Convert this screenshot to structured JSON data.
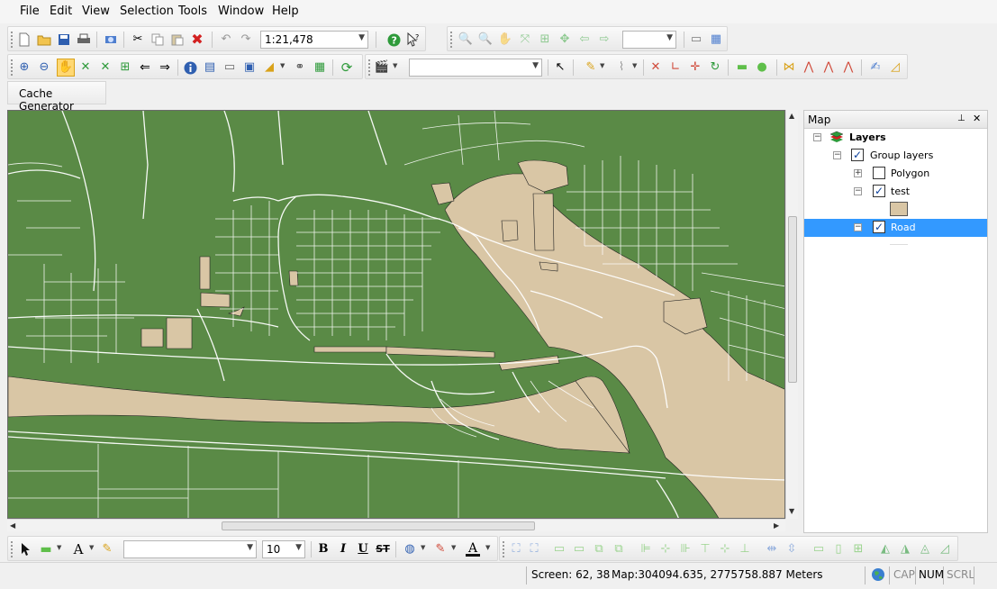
{
  "menu": {
    "items": [
      "File",
      "Edit",
      "View",
      "Selection",
      "Tools",
      "Window",
      "Help"
    ]
  },
  "toolbar": {
    "scale_value": "1:21,478",
    "nav_scale_value": "",
    "layer_select_value": "",
    "cache_tab_label": "Cache Generator"
  },
  "bottom_toolbar": {
    "font_value": "",
    "font_size_value": "10",
    "bold_label": "B",
    "italic_label": "I",
    "underline_label": "U",
    "strike_label": "ST",
    "text_label": "A"
  },
  "layer_panel": {
    "title": "Map",
    "pin_icon": "pin-icon",
    "close_icon": "close-icon",
    "root_label": "Layers",
    "group_label": "Group layers",
    "layers": [
      {
        "label": "Polygon",
        "checked": false,
        "expanded": false
      },
      {
        "label": "test",
        "checked": true,
        "expanded": true
      },
      {
        "label": "Road",
        "checked": true,
        "expanded": true,
        "selected": true
      }
    ],
    "test_symbol_color": "#d9c6a5"
  },
  "status": {
    "screen_label": "Screen: 62, 38",
    "map_label": "Map:304094.635, 2775758.887 Meters",
    "cap": "CAP",
    "num": "NUM",
    "scrl": "SCRL"
  },
  "colors": {
    "map_background": "#5a8a46",
    "polygon_fill": "#d9c6a5",
    "road_stroke": "#ffffff",
    "selection": "#3399ff"
  }
}
